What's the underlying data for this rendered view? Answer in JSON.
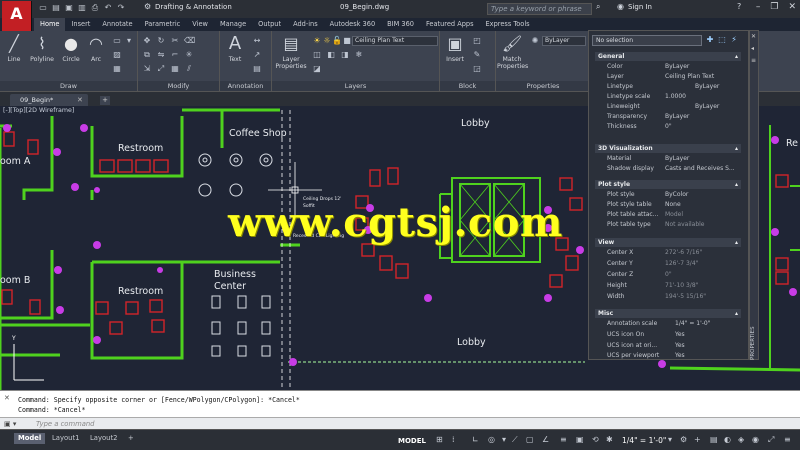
{
  "app": {
    "logo": "A"
  },
  "titlebar": {
    "workspace": "Drafting & Annotation",
    "document": "09_Begin.dwg",
    "search_placeholder": "Type a keyword or phrase",
    "signin": "Sign In"
  },
  "ribbon_tabs": [
    "Home",
    "Insert",
    "Annotate",
    "Parametric",
    "View",
    "Manage",
    "Output",
    "Add-ins",
    "Autodesk 360",
    "BIM 360",
    "Featured Apps",
    "Express Tools"
  ],
  "ribbon": {
    "draw": {
      "label": "Draw",
      "line": "Line",
      "polyline": "Polyline",
      "circle": "Circle",
      "arc": "Arc"
    },
    "modify": {
      "label": "Modify"
    },
    "annotation": {
      "label": "Annotation",
      "text": "Text"
    },
    "layers": {
      "label": "Layers",
      "layer_properties": "Layer Properties",
      "current_layer": "Ceiling Plan Text"
    },
    "block": {
      "label": "Block",
      "insert": "Insert"
    },
    "properties": {
      "label": "Properties",
      "match": "Match Properties",
      "bylayer": "ByLayer"
    }
  },
  "file_tab": {
    "name": "09_Begin*"
  },
  "viewport": {
    "label": "[-][Top][2D Wireframe]"
  },
  "rooms": {
    "coffee_shop": "Coffee Shop",
    "restroom_top": "Restroom",
    "restroom_bottom": "Restroom",
    "room_a": "oom A",
    "room_b": "oom B",
    "business_center_1": "Business",
    "business_center_2": "Center",
    "lobby_top": "Lobby",
    "lobby_bottom": "Lobby",
    "right_re": "Re",
    "ceiling_note_1": "Ceiling Drops 12'",
    "ceiling_note_2": "Soffit",
    "ceiling_note_3": "Recessed Can Lighting"
  },
  "watermark": "www.cgtsj.com",
  "properties": {
    "selection": "No selection",
    "sections": {
      "general": "General",
      "viz3d": "3D Visualization",
      "plotstyle": "Plot style",
      "view": "View",
      "misc": "Misc"
    },
    "general": [
      {
        "k": "Color",
        "v": "ByLayer"
      },
      {
        "k": "Layer",
        "v": "Ceiling Plan Text"
      },
      {
        "k": "Linetype",
        "v": "ByLayer"
      },
      {
        "k": "Linetype scale",
        "v": "1.0000"
      },
      {
        "k": "Lineweight",
        "v": "ByLayer"
      },
      {
        "k": "Transparency",
        "v": "ByLayer"
      },
      {
        "k": "Thickness",
        "v": "0\""
      }
    ],
    "viz3d": [
      {
        "k": "Material",
        "v": "ByLayer"
      },
      {
        "k": "Shadow display",
        "v": "Casts and Receives S..."
      }
    ],
    "plotstyle": [
      {
        "k": "Plot style",
        "v": "ByColor"
      },
      {
        "k": "Plot style table",
        "v": "None"
      },
      {
        "k": "Plot table attac...",
        "v": "Model"
      },
      {
        "k": "Plot table type",
        "v": "Not available"
      }
    ],
    "view": [
      {
        "k": "Center X",
        "v": "272'-6 7/16\""
      },
      {
        "k": "Center Y",
        "v": "126'-7 3/4\""
      },
      {
        "k": "Center Z",
        "v": "0\""
      },
      {
        "k": "Height",
        "v": "71'-10 3/8\""
      },
      {
        "k": "Width",
        "v": "194'-5 15/16\""
      }
    ],
    "misc": [
      {
        "k": "Annotation scale",
        "v": "1/4\" = 1'-0\""
      },
      {
        "k": "UCS icon On",
        "v": "Yes"
      },
      {
        "k": "UCS icon at ori...",
        "v": "Yes"
      },
      {
        "k": "UCS per viewport",
        "v": "Yes"
      }
    ],
    "side_label": "PROPERTIES"
  },
  "command": {
    "line1": "Command: Specify opposite corner or [Fence/WPolygon/CPolygon]: *Cancel*",
    "line2": "Command: *Cancel*",
    "placeholder": "Type a command"
  },
  "layout_tabs": [
    "Model",
    "Layout1",
    "Layout2"
  ],
  "status": {
    "model": "MODEL",
    "scale": "1/4\" = 1'-0\""
  },
  "colors": {
    "wall_green": "#4fd21e",
    "furniture_red": "#d2232a",
    "marker_magenta": "#c83ce6",
    "canvas_bg": "#1f2535",
    "watermark_yellow": "#ffff1e"
  }
}
